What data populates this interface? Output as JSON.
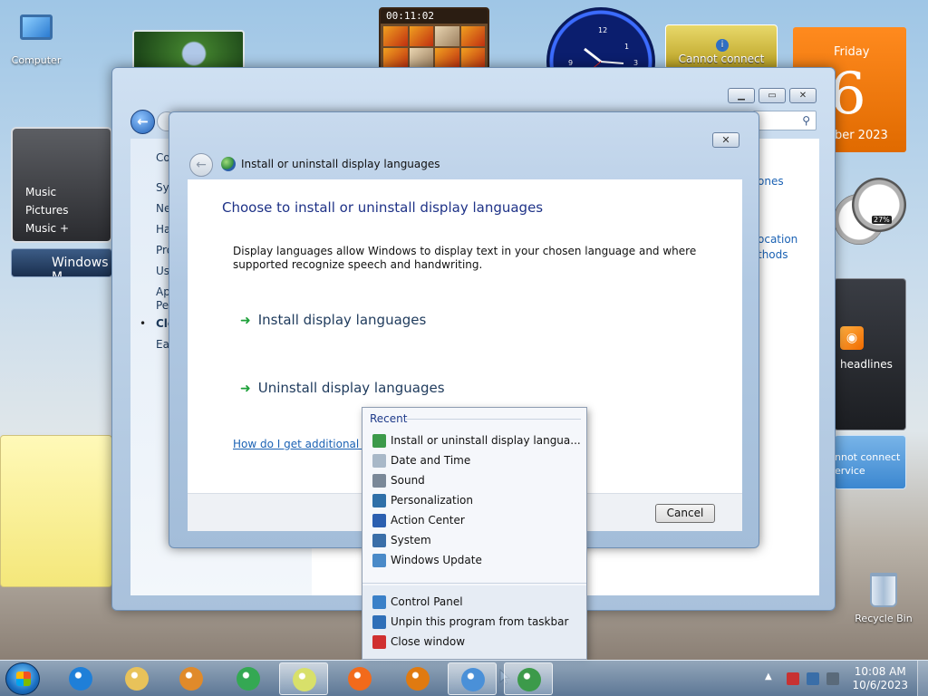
{
  "desktop": {
    "icons": {
      "computer": "Computer",
      "recycle_bin": "Recycle Bin"
    },
    "gadgets": {
      "puzzle_timer": "00:11:02",
      "weather_status": "Cannot connect",
      "calendar": {
        "day_name": "Friday",
        "day_number": "6",
        "month_fragment": "ober 2023"
      },
      "cpu_percent": "27%",
      "media_center": {
        "items": [
          "Music",
          "Pictures",
          "Music + Pictures"
        ],
        "title_fragment": "Windows M"
      },
      "feed_label": "headlines",
      "service_status": [
        "nnot connect",
        "ervice"
      ]
    }
  },
  "control_panel": {
    "sidebar_fragments": [
      "Co",
      "Sys",
      "Ne",
      "Ha",
      "Pro",
      "Use",
      "Ap",
      "Per",
      "Clo",
      "Eas"
    ],
    "right_fragments": [
      "ones",
      "ocation",
      "thods"
    ]
  },
  "dialog": {
    "breadcrumb": "Install or uninstall display languages",
    "heading": "Choose to install or uninstall display languages",
    "description": "Display languages allow Windows to display text in your chosen language and where supported recognize speech and handwriting.",
    "options": [
      "Install display languages",
      "Uninstall display languages"
    ],
    "help_link": "How do I get additional dis",
    "cancel_label": "Cancel",
    "close_glyph": "✕"
  },
  "jumplist": {
    "recent_header": "Recent",
    "recent_items": [
      {
        "label": "Install or uninstall display langua...",
        "icon": "globe-icon",
        "color": "#3c9a4a"
      },
      {
        "label": "Date and Time",
        "icon": "clock-icon",
        "color": "#a8b8c8"
      },
      {
        "label": "Sound",
        "icon": "speaker-icon",
        "color": "#7a8898"
      },
      {
        "label": "Personalization",
        "icon": "monitor-icon",
        "color": "#2f6fa8"
      },
      {
        "label": "Action Center",
        "icon": "flag-icon",
        "color": "#2b5fb0"
      },
      {
        "label": "System",
        "icon": "system-icon",
        "color": "#3a6ea8"
      },
      {
        "label": "Windows Update",
        "icon": "update-icon",
        "color": "#4a8ac8"
      }
    ],
    "tasks": [
      {
        "label": "Control Panel",
        "icon": "control-panel-icon",
        "color": "#3a80c8"
      },
      {
        "label": "Unpin this program from taskbar",
        "icon": "unpin-icon",
        "color": "#2f6fb8"
      },
      {
        "label": "Close window",
        "icon": "close-window-icon",
        "color": "#d03030"
      }
    ]
  },
  "taskbar": {
    "time": "10:08 AM",
    "date": "10/6/2023",
    "apps": [
      {
        "name": "internet-explorer",
        "color": "#1f7fd8"
      },
      {
        "name": "file-explorer",
        "color": "#e8c25a"
      },
      {
        "name": "media-player",
        "color": "#e08a2a"
      },
      {
        "name": "chrome",
        "color": "#34a853"
      },
      {
        "name": "sticky-notes",
        "color": "#d8e06a"
      },
      {
        "name": "firefox",
        "color": "#f26a1b"
      },
      {
        "name": "search",
        "color": "#e07a10"
      },
      {
        "name": "control-panel",
        "color": "#4a90d8"
      },
      {
        "name": "language-settings",
        "color": "#3c9a4a"
      }
    ]
  }
}
